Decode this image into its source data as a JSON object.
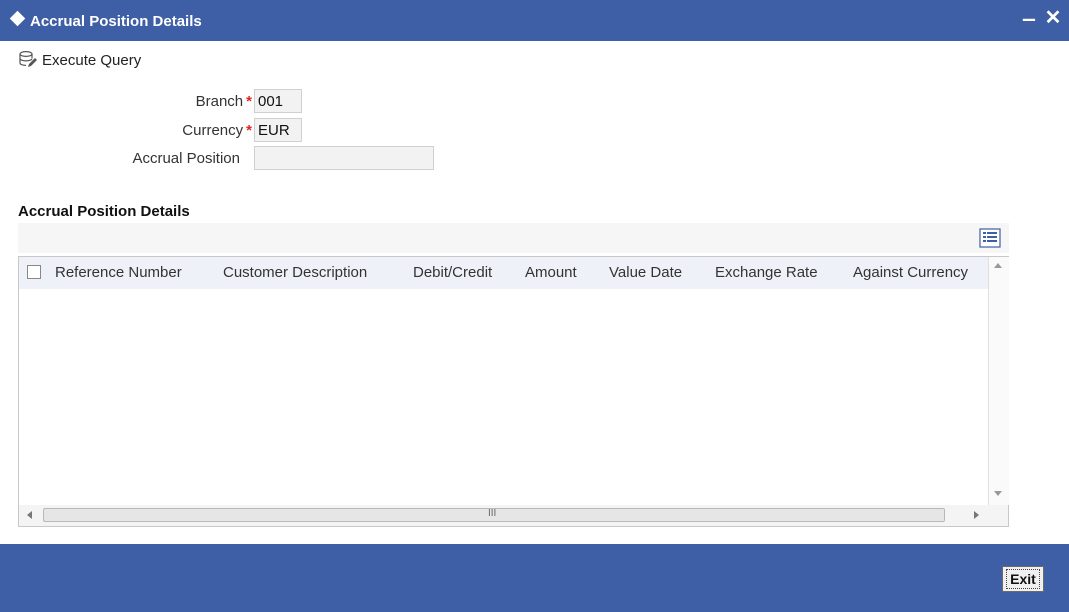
{
  "window": {
    "title": "Accrual Position Details"
  },
  "toolbar": {
    "execute_query_label": "Execute Query"
  },
  "form": {
    "branch": {
      "label": "Branch",
      "required_mark": "*",
      "value": "001"
    },
    "currency": {
      "label": "Currency",
      "required_mark": "*",
      "value": "EUR"
    },
    "accrual_position": {
      "label": "Accrual Position",
      "value": ""
    }
  },
  "grid": {
    "title": "Accrual Position Details",
    "columns": [
      "Reference Number",
      "Customer Description",
      "Debit/Credit",
      "Amount",
      "Value Date",
      "Exchange Rate",
      "Against Currency"
    ],
    "rows": [],
    "hscroll_grip": "III"
  },
  "footer": {
    "exit_label": "Exit"
  },
  "colors": {
    "header_blue": "#3e5ea5",
    "required_red": "#e0231c",
    "grid_header_bg": "#eef2f8"
  },
  "icons": {
    "title": "diamond-icon",
    "execute_query": "database-edit-icon",
    "grid_settings": "column-settings-icon",
    "minimize": "minimize-icon",
    "close": "close-icon"
  }
}
